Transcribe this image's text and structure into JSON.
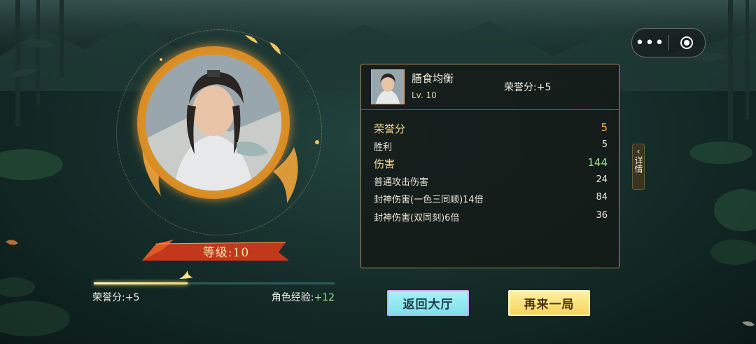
{
  "capsule": {
    "more_label": "•••"
  },
  "player": {
    "level_label": "等级:10"
  },
  "progress": {
    "fill_fraction": 0.39,
    "honor_label": "荣誉分:",
    "honor_value": "+5",
    "exp_label": "角色经验:",
    "exp_value": "+12"
  },
  "panel": {
    "name": "膳食均衡",
    "level": "Lv. 10",
    "header_honor": "荣誉分:+5",
    "stats": [
      {
        "label": "荣誉分",
        "value": "5"
      },
      {
        "label": "胜利",
        "value": "5"
      },
      {
        "label": "伤害",
        "value": "144"
      },
      {
        "label": "普通攻击伤害",
        "value": "24"
      },
      {
        "label": "封神伤害(一色三同顺)14倍",
        "value": "84"
      },
      {
        "label": "封神伤害(双同刻)6倍",
        "value": "36"
      }
    ]
  },
  "detail_tab": {
    "arrow": "‹",
    "label": "详情"
  },
  "buttons": {
    "return_label": "返回大厅",
    "again_label": "再来一局"
  },
  "colors": {
    "accent_gold": "#f4b63d",
    "accent_green": "#9fe28a",
    "panel_border": "#a88b55"
  }
}
